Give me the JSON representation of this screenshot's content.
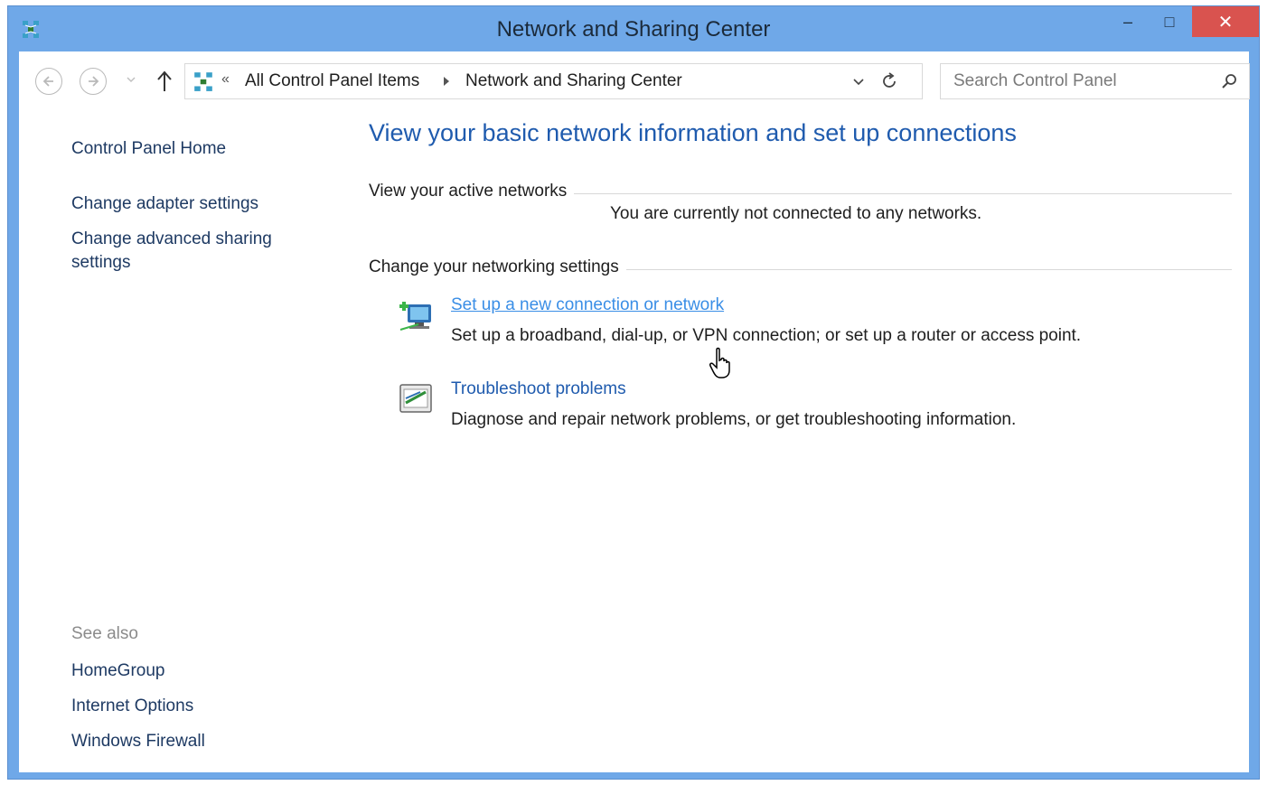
{
  "window": {
    "title": "Network and Sharing Center",
    "controls": {
      "minimize": "–",
      "maximize": "□",
      "close": "✕"
    },
    "close_color": "#d9534f",
    "frame_color": "#6fa8e8"
  },
  "navbar": {
    "breadcrumb_overflow": "«",
    "breadcrumbs": [
      "All Control Panel Items",
      "Network and Sharing Center"
    ],
    "search_placeholder": "Search Control Panel"
  },
  "sidebar": {
    "home": "Control Panel Home",
    "tasks": [
      "Change adapter settings",
      "Change advanced sharing settings"
    ],
    "see_also_label": "See also",
    "see_also": [
      "HomeGroup",
      "Internet Options",
      "Windows Firewall"
    ]
  },
  "main": {
    "title": "View your basic network information and set up connections",
    "active_networks_label": "View your active networks",
    "active_networks_status": "You are currently not connected to any networks.",
    "change_settings_label": "Change your networking settings",
    "tasks": [
      {
        "link": "Set up a new connection or network",
        "description": "Set up a broadband, dial-up, or VPN connection; or set up a router or access point.",
        "icon": "new-connection-icon",
        "state": "hover"
      },
      {
        "link": "Troubleshoot problems",
        "description": "Diagnose and repair network problems, or get troubleshooting information.",
        "icon": "troubleshoot-icon",
        "state": "normal"
      }
    ]
  },
  "colors": {
    "link": "#1f5bae",
    "link_hover": "#3a8ee6",
    "sidebar_link": "#1e3a63",
    "muted": "#8b8b8b"
  }
}
